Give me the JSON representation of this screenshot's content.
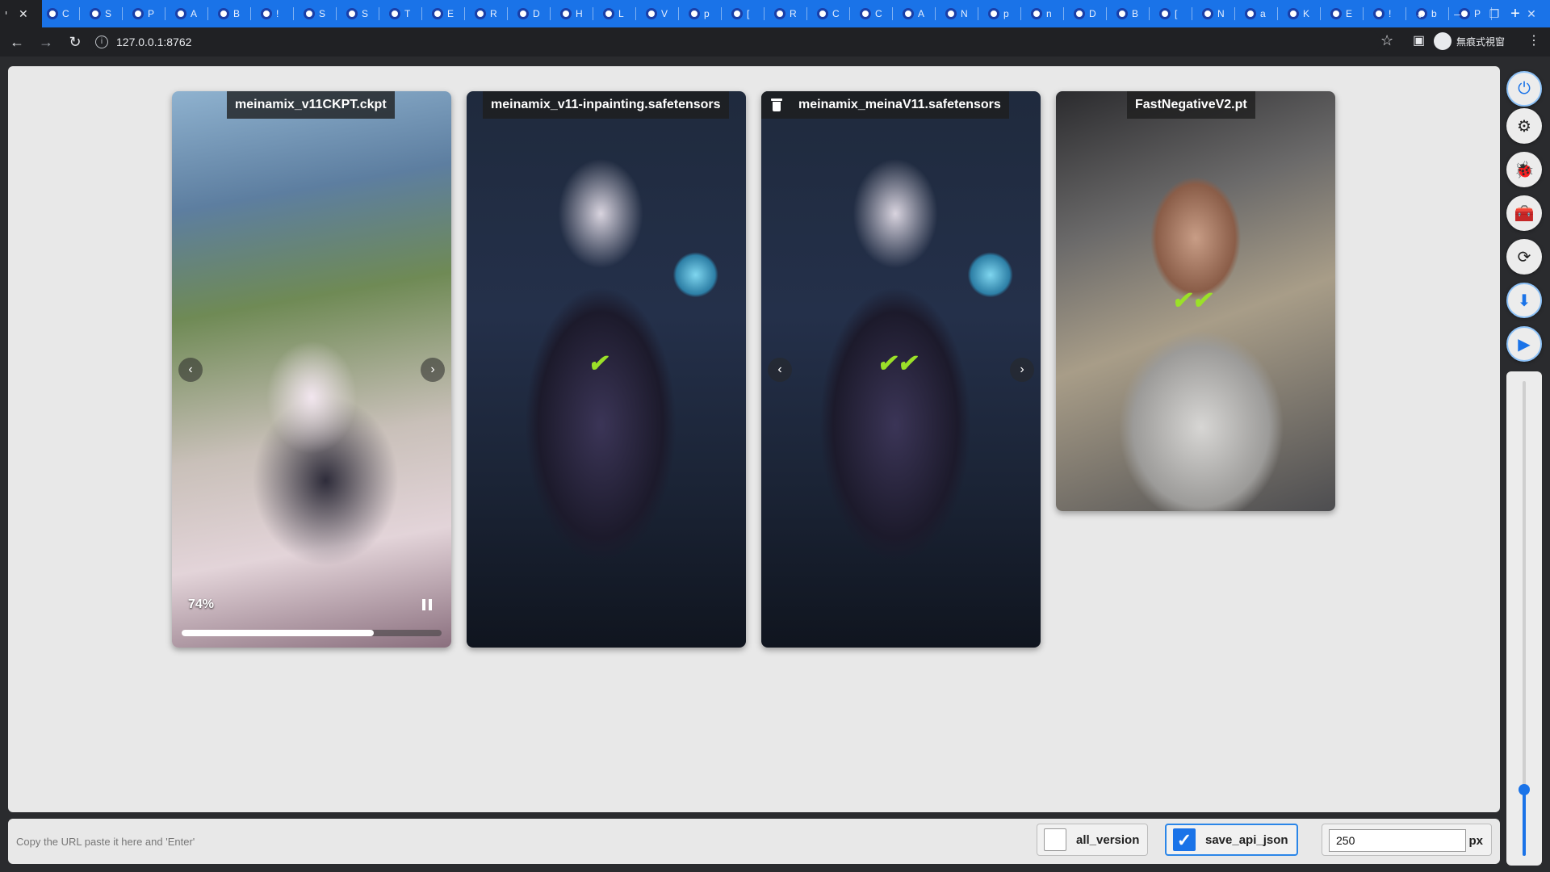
{
  "browser": {
    "active_tab": {
      "label": "י",
      "favicon": "tab-favicon"
    },
    "tabs": [
      {
        "label": "C"
      },
      {
        "label": "S"
      },
      {
        "label": "P"
      },
      {
        "label": "A"
      },
      {
        "label": "B"
      },
      {
        "label": "!"
      },
      {
        "label": "S"
      },
      {
        "label": "S"
      },
      {
        "label": "T"
      },
      {
        "label": "E"
      },
      {
        "label": "R"
      },
      {
        "label": "D"
      },
      {
        "label": "H"
      },
      {
        "label": "L"
      },
      {
        "label": "V"
      },
      {
        "label": "p"
      },
      {
        "label": "["
      },
      {
        "label": "R"
      },
      {
        "label": "C"
      },
      {
        "label": "C"
      },
      {
        "label": "A"
      },
      {
        "label": "N"
      },
      {
        "label": "p"
      },
      {
        "label": "n"
      },
      {
        "label": "D"
      },
      {
        "label": "B"
      },
      {
        "label": "["
      },
      {
        "label": "N"
      },
      {
        "label": "a"
      },
      {
        "label": "K"
      },
      {
        "label": "E"
      },
      {
        "label": "!"
      },
      {
        "label": "b"
      },
      {
        "label": "P"
      }
    ],
    "url": "127.0.0.1:8762",
    "profile_label": "無痕式視窗"
  },
  "cards": [
    {
      "title": "meinamix_v11CKPT.ckpt",
      "image": "anime girl on mountain with pink flowers",
      "progress": {
        "label": "74%",
        "value": 0.74
      }
    },
    {
      "title": "meinamix_v11-inpainting.safetensors",
      "image": "anime girl with glowing blue magic circle"
    },
    {
      "title": "meinamix_meinaV11.safetensors",
      "image": "anime girl with glowing blue magic circle"
    },
    {
      "title": "FastNegativeV2.pt",
      "image": "realistic woman in hoodie in car"
    }
  ],
  "side_toolbar": {
    "buttons": [
      "power-icon",
      "gear-icon",
      "bug-icon",
      "toolbox-icon",
      "refresh-icon",
      "download-icon",
      "play-icon"
    ],
    "slider_value": 250
  },
  "bottom_bar": {
    "url_placeholder": "Copy the URL paste it here and 'Enter'",
    "all_version": {
      "label": "all_version",
      "checked": false
    },
    "save_api_json": {
      "label": "save_api_json",
      "checked": true
    },
    "size_value": "250",
    "size_unit": "px"
  },
  "colors": {
    "accent": "#1a73e8",
    "check_green": "#9be028",
    "tabbar": "#1a73e8"
  }
}
